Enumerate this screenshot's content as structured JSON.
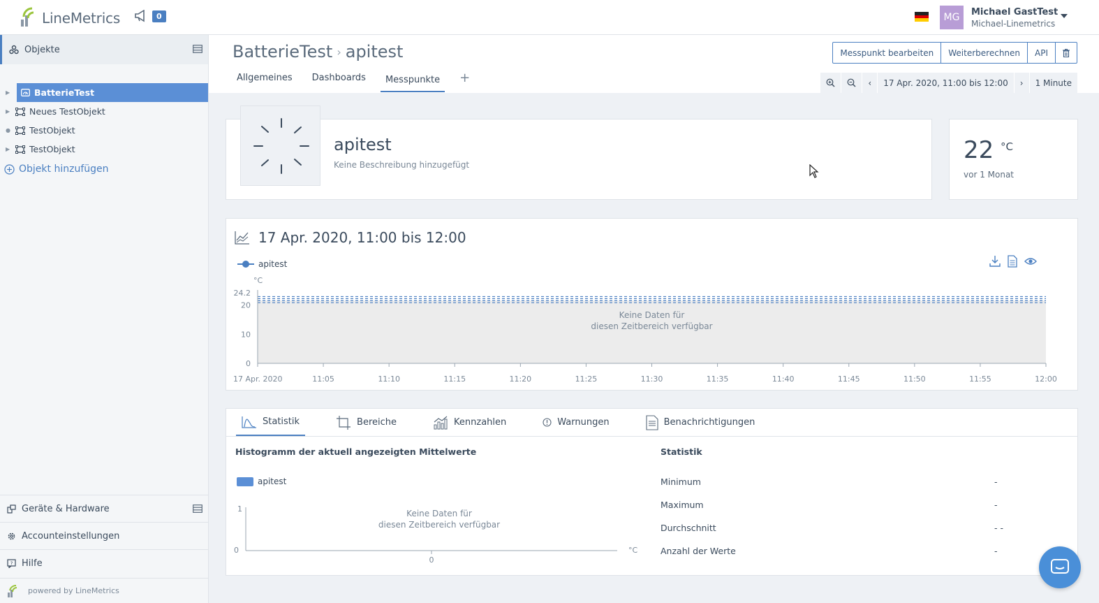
{
  "app": {
    "logo_text": "LineMetrics",
    "notif_count": "0",
    "flag": "DE",
    "user": {
      "initials": "MG",
      "name": "Michael GastTest",
      "account": "Michael-Linemetrics"
    }
  },
  "sidebar": {
    "header_label": "Objekte",
    "tree": [
      {
        "label": "BatterieTest",
        "active": true
      },
      {
        "label": "Neues TestObjekt",
        "active": false
      },
      {
        "label": "TestObjekt",
        "active": false
      },
      {
        "label": "TestObjekt",
        "active": false
      }
    ],
    "add_object_label": "Objekt hinzufügen",
    "bottom_links": [
      {
        "label": "Geräte & Hardware"
      },
      {
        "label": "Accounteinstellungen"
      },
      {
        "label": "Hilfe"
      }
    ],
    "powered_by": "powered by LineMetrics"
  },
  "header": {
    "breadcrumb_parent": "BatterieTest",
    "breadcrumb_current": "apitest",
    "actions": {
      "edit": "Messpunkt bearbeiten",
      "compute": "Weiterberechnen",
      "api": "API"
    },
    "tabs": [
      {
        "label": "Allgemeines"
      },
      {
        "label": "Dashboards"
      },
      {
        "label": "Messpunkte",
        "active": true
      }
    ],
    "time_range": "17 Apr. 2020, 11:00 bis 12:00",
    "interval": "1 Minute"
  },
  "measure_point": {
    "title": "apitest",
    "description": "Keine Beschreibung hinzugefügt",
    "last_value": "22",
    "unit": "°C",
    "last_value_age": "vor 1 Monat"
  },
  "chart": {
    "title": "17 Apr. 2020, 11:00 bis 12:00",
    "no_data_line1": "Keine Daten für",
    "no_data_line2": "diesen Zeitbereich verfügbar"
  },
  "chart_data": {
    "type": "line",
    "series": [
      {
        "name": "apitest",
        "values": []
      }
    ],
    "ylabel": "°C",
    "yticks": [
      "0",
      "10",
      "20",
      "24.2"
    ],
    "xticks": [
      "17 Apr. 2020",
      "11:05",
      "11:10",
      "11:15",
      "11:20",
      "11:25",
      "11:30",
      "11:35",
      "11:40",
      "11:45",
      "11:50",
      "11:55",
      "12:00"
    ],
    "ylim": [
      0,
      24.2
    ],
    "grid": false,
    "reference_lines": [
      20.8,
      21.5,
      22.2,
      22.9
    ]
  },
  "stats": {
    "tabs": [
      {
        "label": "Statistik",
        "active": true
      },
      {
        "label": "Bereiche"
      },
      {
        "label": "Kennzahlen"
      },
      {
        "label": "Warnungen"
      },
      {
        "label": "Benachrichtigungen"
      }
    ],
    "histogram_title": "Histogramm der aktuell angezeigten Mittelwerte",
    "histogram_legend": "apitest",
    "histogram_no_data_1": "Keine Daten für",
    "histogram_no_data_2": "diesen Zeitbereich verfügbar",
    "histogram_y_top": "1",
    "histogram_y_bottom": "0",
    "histogram_x": "0",
    "histogram_unit": "°C",
    "stat_title": "Statistik",
    "rows": [
      {
        "label": "Minimum",
        "value": "-"
      },
      {
        "label": "Maximum",
        "value": "-"
      },
      {
        "label": "Durchschnitt",
        "value": "- -"
      },
      {
        "label": "Anzahl der Werte",
        "value": "-"
      }
    ]
  }
}
